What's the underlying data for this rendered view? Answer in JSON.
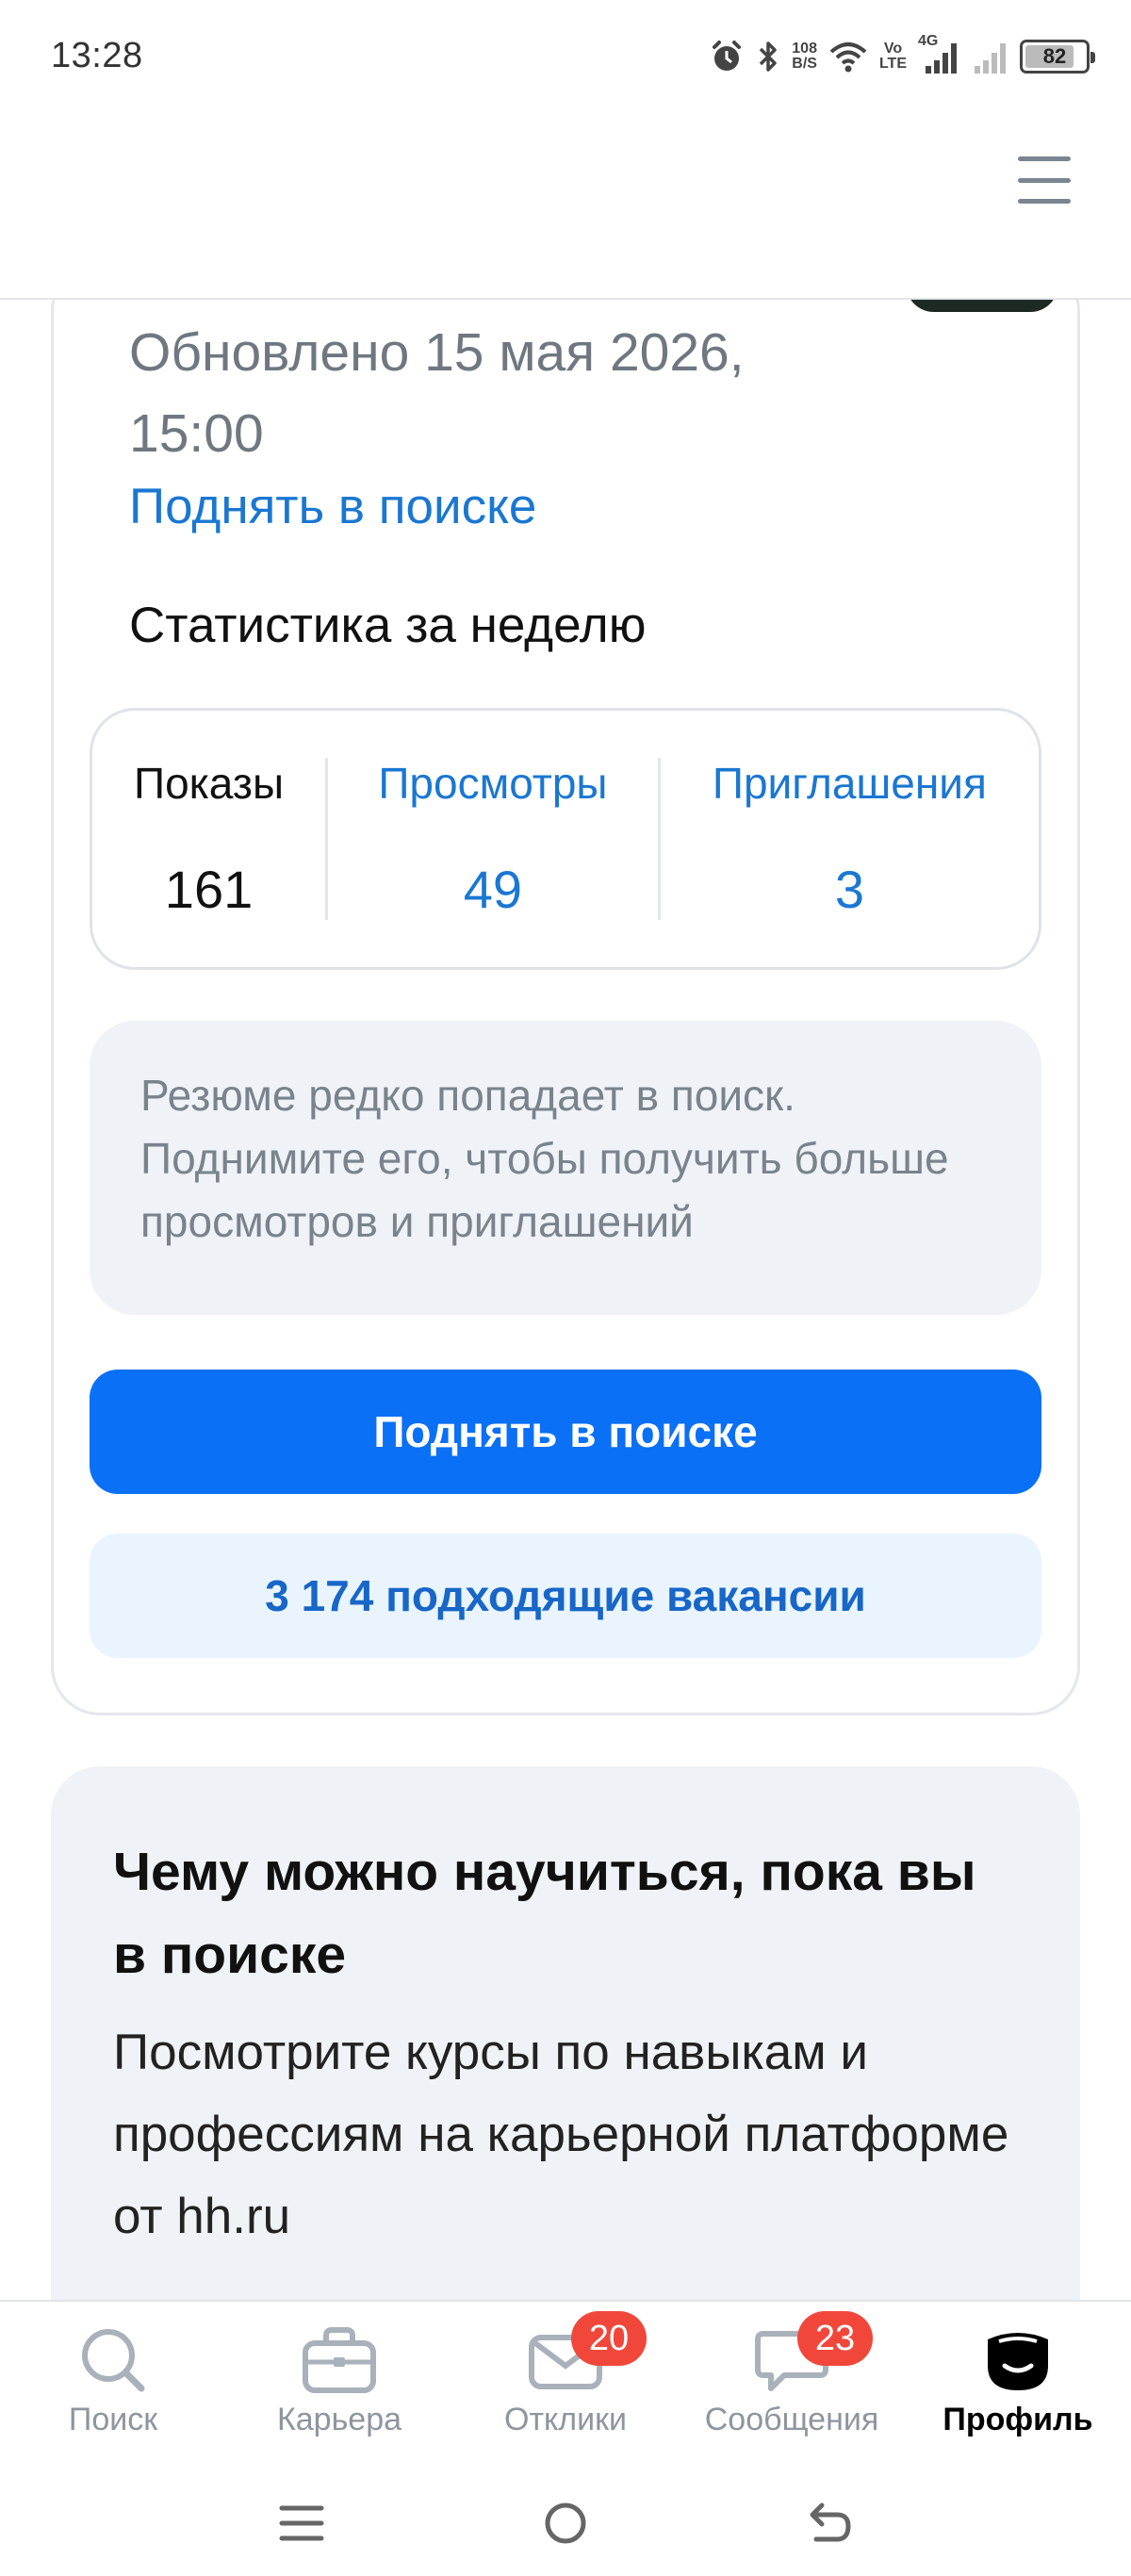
{
  "status_bar": {
    "time": "13:28",
    "net_speed_value": "108",
    "net_speed_unit": "B/S",
    "volte_top": "Vo",
    "volte_bottom": "LTE",
    "network": "4G",
    "battery": "82",
    "battery_level": 0.82,
    "icons": [
      "alarm-icon",
      "bluetooth-icon",
      "wifi-icon",
      "signal-icon"
    ]
  },
  "resume": {
    "updated_text": "Обновлено 15 мая 2026, 15:00",
    "raise_link": "Поднять в поиске",
    "stats_title": "Статистика за неделю",
    "stats": [
      {
        "label": "Показы",
        "value": "161"
      },
      {
        "label": "Просмотры",
        "value": "49"
      },
      {
        "label": "Приглашения",
        "value": "3"
      }
    ],
    "hint": "Резюме редко попадает в поиск. Поднимите его, чтобы получить больше просмотров и приглашений",
    "raise_button": "Поднять в поиске",
    "vacancies_button": "3 174 подходящие вакансии"
  },
  "learn_card": {
    "title": "Чему можно научиться, пока вы в поиске",
    "text": "Посмотрите курсы по навыкам и профессиям на карьерной платформе от hh.ru"
  },
  "bottom_nav": {
    "items": [
      {
        "label": "Поиск",
        "icon": "search-icon",
        "badge": null,
        "active": false
      },
      {
        "label": "Карьера",
        "icon": "briefcase-icon",
        "badge": null,
        "active": false
      },
      {
        "label": "Отклики",
        "icon": "mail-icon",
        "badge": "20",
        "active": false
      },
      {
        "label": "Сообщения",
        "icon": "chat-icon",
        "badge": "23",
        "active": false
      },
      {
        "label": "Профиль",
        "icon": "profile-icon",
        "badge": null,
        "active": true
      }
    ]
  },
  "colors": {
    "accent": "#0a70f5",
    "link": "#1a77d2",
    "badge": "#f1473b",
    "muted_text": "#6f7880",
    "card_bg": "#eff2f6"
  }
}
